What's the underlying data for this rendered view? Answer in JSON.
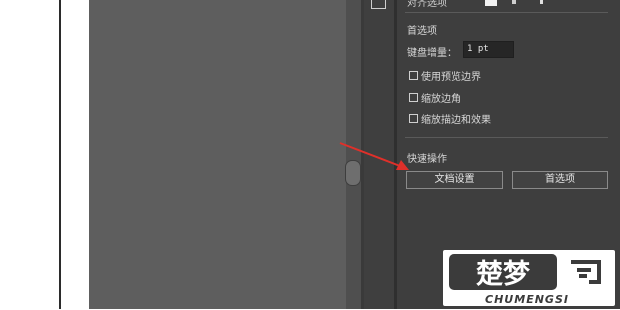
{
  "panel": {
    "top_row_label": "对齐选项",
    "preferences": {
      "title": "首选项",
      "keyboard_increment_label": "键盘增量：",
      "keyboard_increment_value": "1 pt",
      "checkboxes": [
        {
          "label": "使用预览边界",
          "checked": false
        },
        {
          "label": "缩放边角",
          "checked": false
        },
        {
          "label": "缩放描边和效果",
          "checked": false
        }
      ]
    },
    "quick_actions": {
      "title": "快速操作",
      "document_settings_label": "文档设置",
      "preferences_label": "首选项"
    }
  },
  "watermark": {
    "big_text": "楚梦",
    "small_text": "CHUMENGSI"
  },
  "colors": {
    "panel_bg": "#3e3e3e",
    "canvas_bg": "#5e5e5e",
    "arrow": "#e0302a"
  }
}
